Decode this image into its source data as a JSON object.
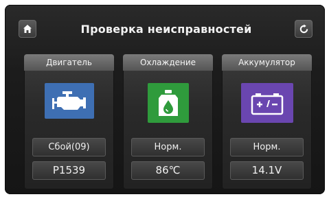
{
  "header": {
    "title": "Проверка неисправностей"
  },
  "icons": {
    "home": "home-icon",
    "refresh": "refresh-icon"
  },
  "cards": [
    {
      "label": "Двигатель",
      "icon": "engine-icon",
      "color": "#3e6fb3",
      "status": "Сбой(09)",
      "value": "P1539"
    },
    {
      "label": "Охлаждение",
      "icon": "coolant-icon",
      "color": "#2f9b3c",
      "status": "Норм.",
      "value": "86℃"
    },
    {
      "label": "Аккумулятор",
      "icon": "battery-icon",
      "color": "#6a46b0",
      "status": "Норм.",
      "value": "14.1V"
    }
  ]
}
